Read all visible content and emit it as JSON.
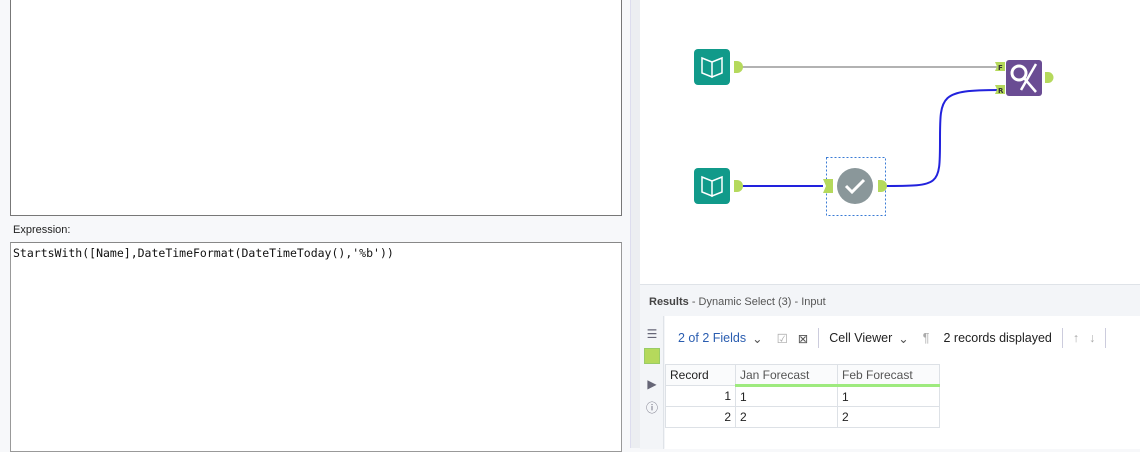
{
  "expression": {
    "label": "Expression:",
    "value": "StartsWith([Name],DateTimeFormat(DateTimeToday(),'%b'))"
  },
  "results": {
    "title": "Results",
    "subtitle": "- Dynamic Select (3) - Input",
    "fields_label": "2 of 2 Fields",
    "cell_viewer": "Cell Viewer",
    "records": "2 records displayed",
    "columns": [
      "Record",
      "Jan Forecast",
      "Feb Forecast"
    ],
    "rows": [
      [
        "1",
        "1",
        "1"
      ],
      [
        "2",
        "2",
        "2"
      ]
    ]
  },
  "workflow": {
    "anchor_f": "F",
    "anchor_r": "R"
  },
  "colors": {
    "input_tool": "#119a8a",
    "filter_tool": "#6a4c93",
    "selected_tool": "#8a979a",
    "connection": "#2222dd",
    "anchor": "#b5d95c"
  }
}
